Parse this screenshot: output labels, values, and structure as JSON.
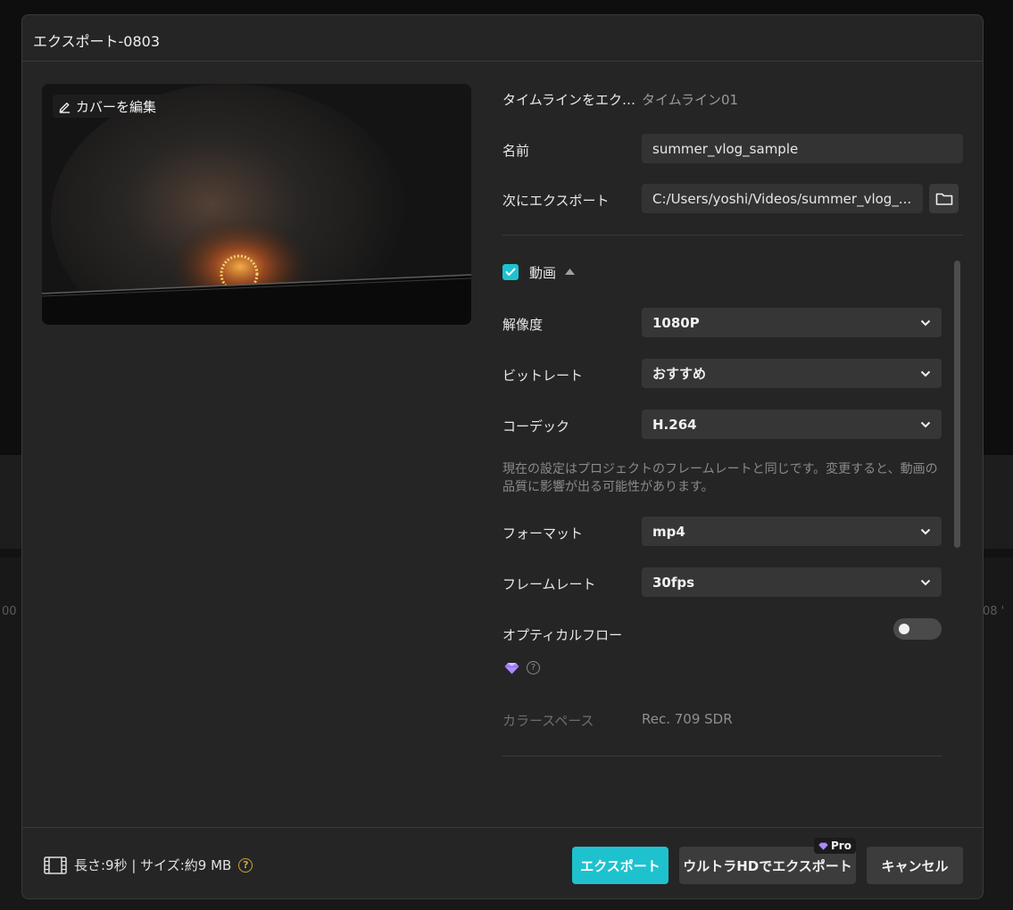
{
  "dialog": {
    "title": "エクスポート-0803"
  },
  "background": {
    "left_fragment": "00",
    "right_fragment": "08 '"
  },
  "preview": {
    "edit_cover_label": "カバーを編集"
  },
  "form": {
    "timeline_label": "タイムラインをエク…",
    "timeline_value": "タイムライン01",
    "name_label": "名前",
    "name_value": "summer_vlog_sample",
    "export_to_label": "次にエクスポート",
    "export_to_value": "C:/Users/yoshi/Videos/summer_vlog_..."
  },
  "video": {
    "section_label": "動画",
    "enabled": true,
    "resolution_label": "解像度",
    "resolution_value": "1080P",
    "bitrate_label": "ビットレート",
    "bitrate_value": "おすすめ",
    "codec_label": "コーデック",
    "codec_value": "H.264",
    "note": "現在の設定はプロジェクトのフレームレートと同じです。変更すると、動画の品質に影響が出る可能性があります。",
    "format_label": "フォーマット",
    "format_value": "mp4",
    "framerate_label": "フレームレート",
    "framerate_value": "30fps",
    "optical_flow_label": "オプティカルフロー",
    "optical_flow_enabled": false,
    "colorspace_label": "カラースペース",
    "colorspace_value": "Rec. 709 SDR"
  },
  "footer": {
    "info": "長さ:9秒 | サイズ:約9 MB",
    "export_button": "エクスポート",
    "uhd_button": "ウルトラHDでエクスポート",
    "pro_badge": "Pro",
    "cancel_button": "キャンセル"
  },
  "colors": {
    "accent": "#1ec2cf",
    "dialog_bg": "#252525",
    "field_bg": "#333333",
    "premium": "#a98bff",
    "help_gold": "#c9a63a"
  }
}
